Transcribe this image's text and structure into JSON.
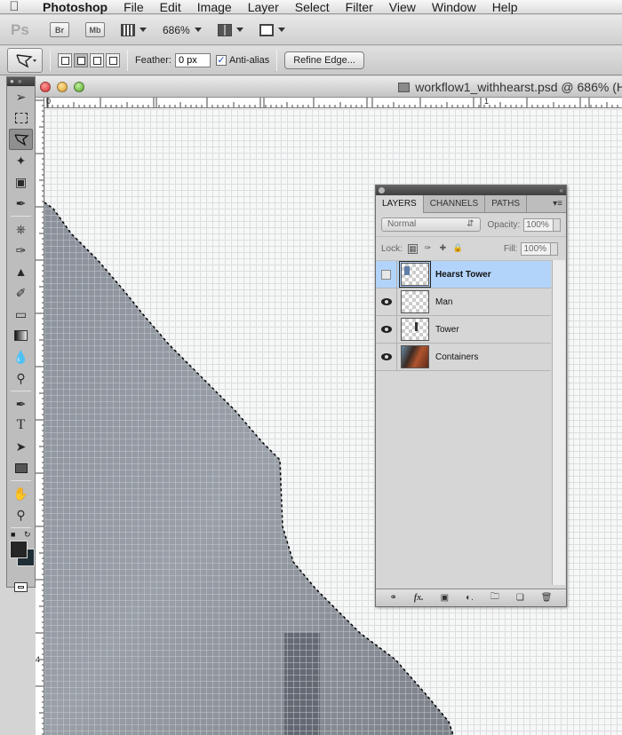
{
  "menubar": {
    "app_name": "Photoshop",
    "items": [
      "File",
      "Edit",
      "Image",
      "Layer",
      "Select",
      "Filter",
      "View",
      "Window",
      "Help"
    ]
  },
  "appbar": {
    "logo": "Ps",
    "bridge": "Br",
    "minibridge": "Mb",
    "zoom": "686%"
  },
  "options": {
    "feather_label": "Feather:",
    "feather_value": "0 px",
    "antialias_label": "Anti-alias",
    "antialias_checked": true,
    "refine_edge": "Refine Edge..."
  },
  "document": {
    "title": "workflow1_withhearst.psd @ 686% (H",
    "ruler": {
      "h_labels": [
        "0",
        "1"
      ],
      "v_labels": [
        "4"
      ]
    }
  },
  "layers_panel": {
    "tabs": [
      "LAYERS",
      "CHANNELS",
      "PATHS"
    ],
    "active_tab": "LAYERS",
    "blend_mode": "Normal",
    "opacity_label": "Opacity:",
    "opacity_value": "100%",
    "lock_label": "Lock:",
    "fill_label": "Fill:",
    "fill_value": "100%",
    "layers": [
      {
        "name": "Hearst Tower",
        "visible": false,
        "selected": true
      },
      {
        "name": "Man",
        "visible": true,
        "selected": false
      },
      {
        "name": "Tower",
        "visible": true,
        "selected": false
      },
      {
        "name": "Containers",
        "visible": true,
        "selected": false
      }
    ]
  }
}
